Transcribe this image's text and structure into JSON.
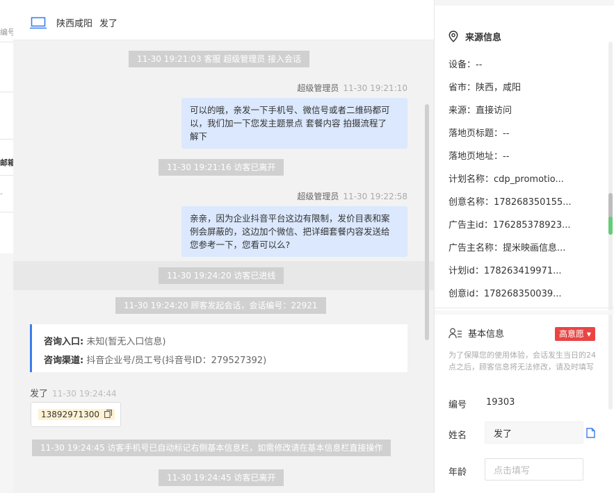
{
  "background_page": {
    "frag1": "编号",
    "frag2": "邮箱",
    "frag3": "-"
  },
  "chat": {
    "header": {
      "location": "陕西咸阳",
      "name": "发了",
      "icon": "laptop-icon"
    },
    "system_messages": [
      "11-30 19:21:03 客服 超级管理员 接入会话",
      "11-30 19:21:16 访客已离开",
      "11-30 19:24:20 访客已进线",
      "11-30 19:24:20 顾客发起会话，会话编号：22921",
      "11-30 19:24:45 访客手机号已自动标记右侧基本信息栏，如需修改请在基本信息栏直接操作",
      "11-30 19:24:45 访客已离开"
    ],
    "agent_messages": [
      {
        "sender": "超级管理员",
        "time": "11-30 19:21:10",
        "lines": [
          "可以的哦，亲发一下手机号、微信号或者二维码都可",
          "以，我们加一下您发主题景点 套餐内容 拍摄流程了",
          "解下"
        ]
      },
      {
        "sender": "超级管理员",
        "time": "11-30 19:22:58",
        "lines": [
          "亲亲，因为企业抖音平台这边有限制，发价目表和案",
          "例会屏蔽的，这边加个微信、把详细套餐内容发送给",
          "您参考一下，您看可以么?"
        ]
      }
    ],
    "info_card": {
      "entry_label": "咨询入口:",
      "entry_value": "未知(暂无入口信息)",
      "channel_label": "咨询渠道:",
      "channel_value": "抖音企业号/员工号(抖音号ID：279527392)"
    },
    "visitor_message": {
      "sender": "发了",
      "time": "11-30 19:24:44",
      "phone": "13892971300",
      "copy_icon": "copy-icon"
    }
  },
  "source_info": {
    "title": "来源信息",
    "icon": "location-pin-icon",
    "rows": [
      "设备：--",
      "省市：陕西，咸阳",
      "来源：直接访问",
      "落地页标题：--",
      "落地页地址：--",
      "计划名称：cdp_promotio...",
      "创意名称：178268350155...",
      "广告主id：176285378923...",
      "广告主名称：提米映画信息...",
      "计划id：178263419971...",
      "创意id：178268350039..."
    ]
  },
  "basic_info": {
    "title": "基本信息",
    "icon": "user-list-icon",
    "intent_badge": "高意愿",
    "notice": "为了保障您的使用体验，会话发生当日的24点之后，顾客信息将无法修改，请及时填写",
    "id_label": "编号",
    "id_value": "19303",
    "name_label": "姓名",
    "name_value": "发了",
    "age_label": "年龄",
    "age_placeholder": "点击填写"
  },
  "colors": {
    "accent": "#3b7ded",
    "bubble": "#dbe8fd",
    "intent": "#e84545"
  }
}
